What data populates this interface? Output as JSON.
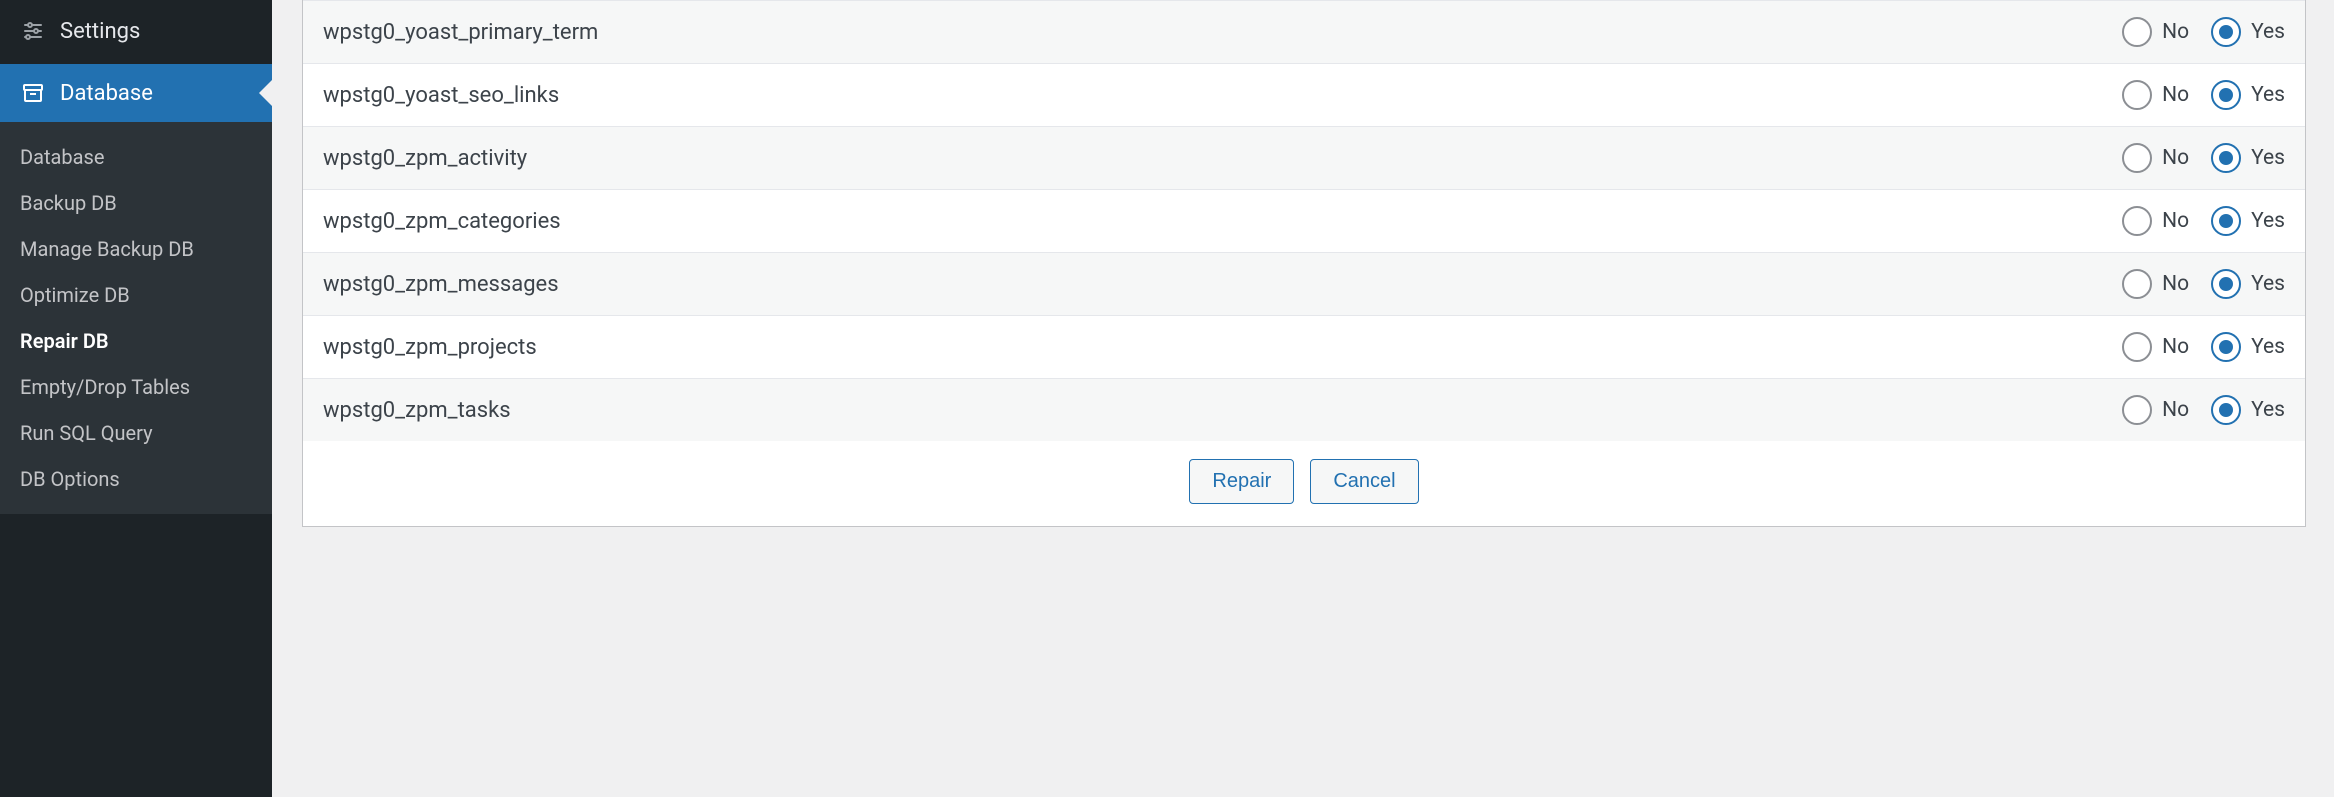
{
  "sidebar": {
    "top": {
      "label": "Settings"
    },
    "active_header": {
      "label": "Database"
    },
    "sub_items": [
      {
        "label": "Database",
        "current": false
      },
      {
        "label": "Backup DB",
        "current": false
      },
      {
        "label": "Manage Backup DB",
        "current": false
      },
      {
        "label": "Optimize DB",
        "current": false
      },
      {
        "label": "Repair DB",
        "current": true
      },
      {
        "label": "Empty/Drop Tables",
        "current": false
      },
      {
        "label": "Run SQL Query",
        "current": false
      },
      {
        "label": "DB Options",
        "current": false
      }
    ]
  },
  "labels": {
    "no": "No",
    "yes": "Yes"
  },
  "rows": [
    {
      "name": "wpstg0_yoast_primary_term",
      "value": "yes"
    },
    {
      "name": "wpstg0_yoast_seo_links",
      "value": "yes"
    },
    {
      "name": "wpstg0_zpm_activity",
      "value": "yes"
    },
    {
      "name": "wpstg0_zpm_categories",
      "value": "yes"
    },
    {
      "name": "wpstg0_zpm_messages",
      "value": "yes"
    },
    {
      "name": "wpstg0_zpm_projects",
      "value": "yes"
    },
    {
      "name": "wpstg0_zpm_tasks",
      "value": "yes"
    }
  ],
  "actions": {
    "repair": "Repair",
    "cancel": "Cancel"
  }
}
